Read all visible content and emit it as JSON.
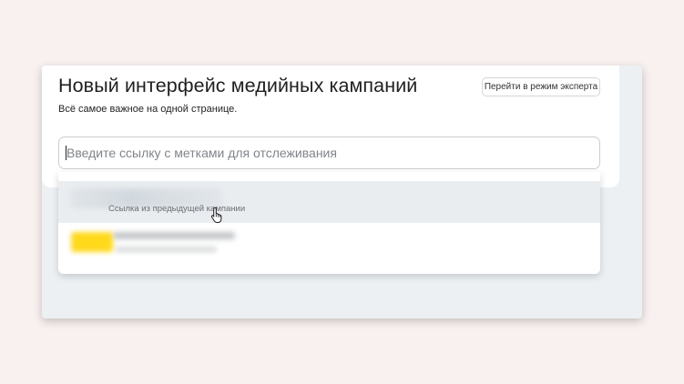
{
  "header": {
    "title": "Новый интерфейс медийных кампаний",
    "subtitle": "Всё самое важное на одной странице.",
    "expert_mode_label": "Перейти в режим эксперта"
  },
  "search": {
    "placeholder": "Введите ссылку с метками для отслеживания",
    "value": ""
  },
  "suggestions": {
    "items": [
      {
        "label": "Ссылка из предыдущей кампании"
      }
    ]
  },
  "colors": {
    "page_background": "#f8f1f0",
    "panel_background": "#ecf0f3",
    "highlight_row": "#eaedf0",
    "logo_yellow": "#ffd91a"
  },
  "icons": {
    "cursor": "hand-pointer-icon"
  }
}
